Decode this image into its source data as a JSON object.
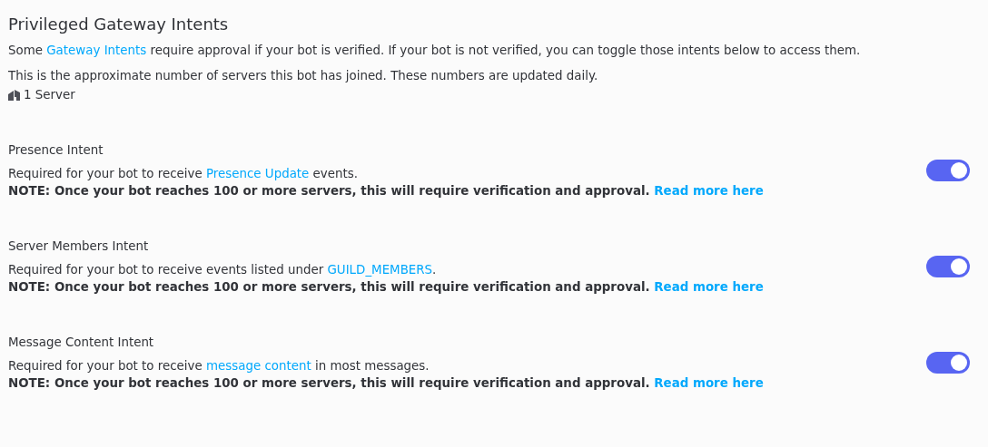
{
  "title": "Privileged Gateway Intents",
  "intro": {
    "before": "Some ",
    "link": "Gateway Intents",
    "after": " require approval if your bot is verified. If your bot is not verified, you can toggle those intents below to access them."
  },
  "servers_note": "This is the approximate number of servers this bot has joined. These numbers are updated daily.",
  "server_count": "1 Server",
  "intents": [
    {
      "name": "Presence Intent",
      "before": "Required for your bot to receive ",
      "link": "Presence Update",
      "after": " events.",
      "note": "NOTE: Once your bot reaches 100 or more servers, this will require verification and approval.",
      "note_link": "Read more here",
      "on": true
    },
    {
      "name": "Server Members Intent",
      "before": "Required for your bot to receive events listed under ",
      "link": "GUILD_MEMBERS",
      "after": ".",
      "note": "NOTE: Once your bot reaches 100 or more servers, this will require verification and approval.",
      "note_link": "Read more here",
      "on": true
    },
    {
      "name": "Message Content Intent",
      "before": "Required for your bot to receive ",
      "link": "message content",
      "after": " in most messages.",
      "note": "NOTE: Once your bot reaches 100 or more servers, this will require verification and approval.",
      "note_link": "Read more here",
      "on": true
    }
  ]
}
